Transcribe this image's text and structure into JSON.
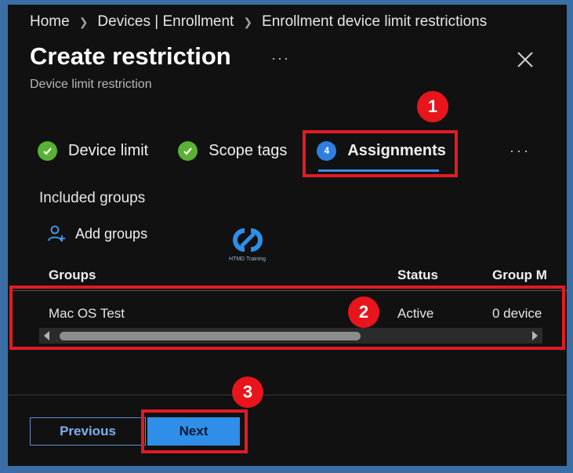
{
  "breadcrumb": {
    "items": [
      "Home",
      "Devices | Enrollment",
      "Enrollment device limit restrictions"
    ]
  },
  "header": {
    "title": "Create restriction",
    "subtitle": "Device limit restriction",
    "more_label": "···",
    "close_icon": "close-icon"
  },
  "tabs": {
    "items": [
      {
        "label": "Device limit",
        "state": "completed",
        "icon": "check-icon"
      },
      {
        "label": "Scope tags",
        "state": "completed",
        "icon": "check-icon"
      },
      {
        "label": "Assignments",
        "state": "active",
        "step": "4"
      }
    ],
    "more_label": "···"
  },
  "assignments": {
    "section_label": "Included groups",
    "add_groups_label": "Add groups",
    "columns": [
      "Groups",
      "Status",
      "Group M"
    ],
    "rows": [
      {
        "group": "Mac OS Test",
        "status": "Active",
        "members": "0 device"
      }
    ]
  },
  "watermark": {
    "text": "HTMD Training"
  },
  "annotations": {
    "badges": [
      "1",
      "2",
      "3"
    ],
    "color": "#e01c24"
  },
  "footer": {
    "previous_label": "Previous",
    "next_label": "Next"
  },
  "colors": {
    "accent": "#2f8ee8",
    "success": "#58b233",
    "background": "#111111"
  }
}
